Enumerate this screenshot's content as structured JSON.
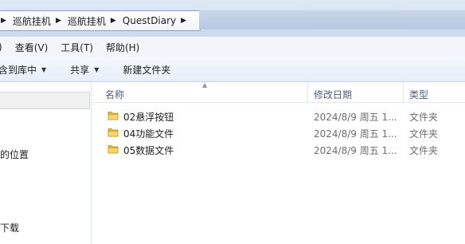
{
  "breadcrumb": {
    "items": [
      "巡航挂机",
      "巡航挂机",
      "QuestDiary"
    ]
  },
  "menu": {
    "items": [
      "查看(V)",
      "工具(T)",
      "帮助(H)"
    ],
    "cut_left": ")"
  },
  "toolbar": {
    "include_library": "含到库中",
    "share": "共享",
    "new_folder": "新建文件夹"
  },
  "nav": {
    "items": [
      "的位置",
      "下载"
    ]
  },
  "columns": {
    "name": "名称",
    "modified": "修改日期",
    "type": "类型"
  },
  "files": [
    {
      "name": "02悬浮按钮",
      "modified": "2024/8/9 周五 1...",
      "type": "文件夹"
    },
    {
      "name": "04功能文件",
      "modified": "2024/8/9 周五 1...",
      "type": "文件夹"
    },
    {
      "name": "05数据文件",
      "modified": "2024/8/9 周五 1...",
      "type": "文件夹"
    }
  ],
  "icons": {
    "folder": "folder-icon",
    "sep": "chevron-right-icon",
    "dropdown": "caret-down-icon"
  },
  "colors": {
    "header_text": "#4c607a",
    "folder_yellow": "#f2c94c"
  }
}
